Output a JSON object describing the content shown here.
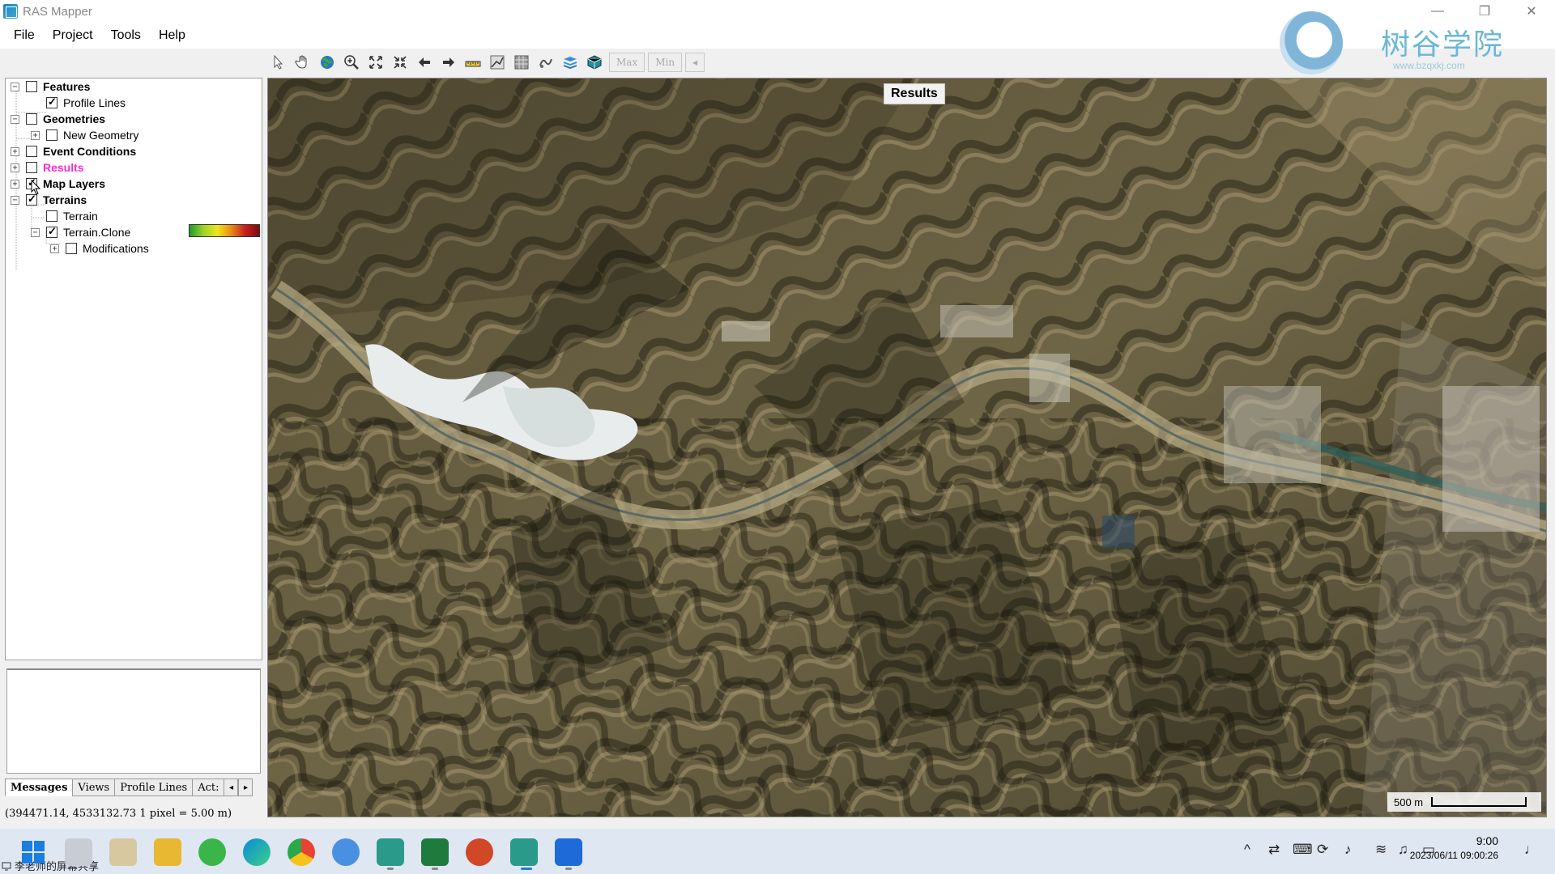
{
  "window": {
    "title": "RAS Mapper",
    "minimize_glyph": "—",
    "restore_glyph": "❐",
    "close_glyph": "✕"
  },
  "menu": [
    "File",
    "Project",
    "Tools",
    "Help"
  ],
  "logo": {
    "text": "树谷学院",
    "url": "www.bzqxkj.com"
  },
  "toolbar": {
    "icons": [
      "select-arrow-icon",
      "pan-hand-icon",
      "globe-icon",
      "zoom-in-icon",
      "zoom-extent-icon",
      "full-extent-icon",
      "back-arrow-icon",
      "forward-arrow-icon",
      "measure-icon",
      "profile-icon",
      "grid-icon",
      "plot-icon",
      "layers-icon",
      "3d-icon"
    ],
    "max_label": "Max",
    "min_label": "Min",
    "more_glyph": "◂"
  },
  "layers": {
    "features": {
      "label": "Features",
      "expander": "−",
      "checked": false
    },
    "profile_lines": {
      "label": "Profile Lines",
      "checked": true
    },
    "geometries": {
      "label": "Geometries",
      "expander": "−",
      "checked": false
    },
    "new_geometry": {
      "label": "New Geometry",
      "expander": "+",
      "checked": false
    },
    "event_conditions": {
      "label": "Event Conditions",
      "expander": "+",
      "checked": false
    },
    "results": {
      "label": "Results",
      "expander": "+",
      "checked": false
    },
    "map_layers": {
      "label": "Map Layers",
      "expander": "+",
      "checked": true
    },
    "terrains": {
      "label": "Terrains",
      "expander": "−",
      "checked": true
    },
    "terrain": {
      "label": "Terrain",
      "checked": false
    },
    "terrain_clone": {
      "label": "Terrain.Clone",
      "expander": "−",
      "checked": true
    },
    "modifications": {
      "label": "Modifications",
      "expander": "+",
      "checked": false
    }
  },
  "tabs": [
    "Messages",
    "Views",
    "Profile Lines",
    "Act:"
  ],
  "tab_arrows": {
    "left": "◂",
    "right": "▸"
  },
  "statusbar": {
    "coords": "(394471.14, 4533132.73  1 pixel = 5.00 m)"
  },
  "map": {
    "results_label": "Results",
    "scale_label": "500 m"
  },
  "taskbar": {
    "share_label": "李老师的屏幕共享",
    "time": "9:00",
    "date": "2023/06/11 09:00:26",
    "apps": [
      "start",
      "task-view",
      "tool",
      "explorer",
      "browser-green",
      "edge",
      "chrome",
      "cloud",
      "hec-ras",
      "excel",
      "powerpoint",
      "hec-ras-2",
      "mapper"
    ],
    "tray_up_glyph": "^"
  },
  "colors": {
    "results_label": "#ff2ad4",
    "accent": "#1f7fbf"
  }
}
